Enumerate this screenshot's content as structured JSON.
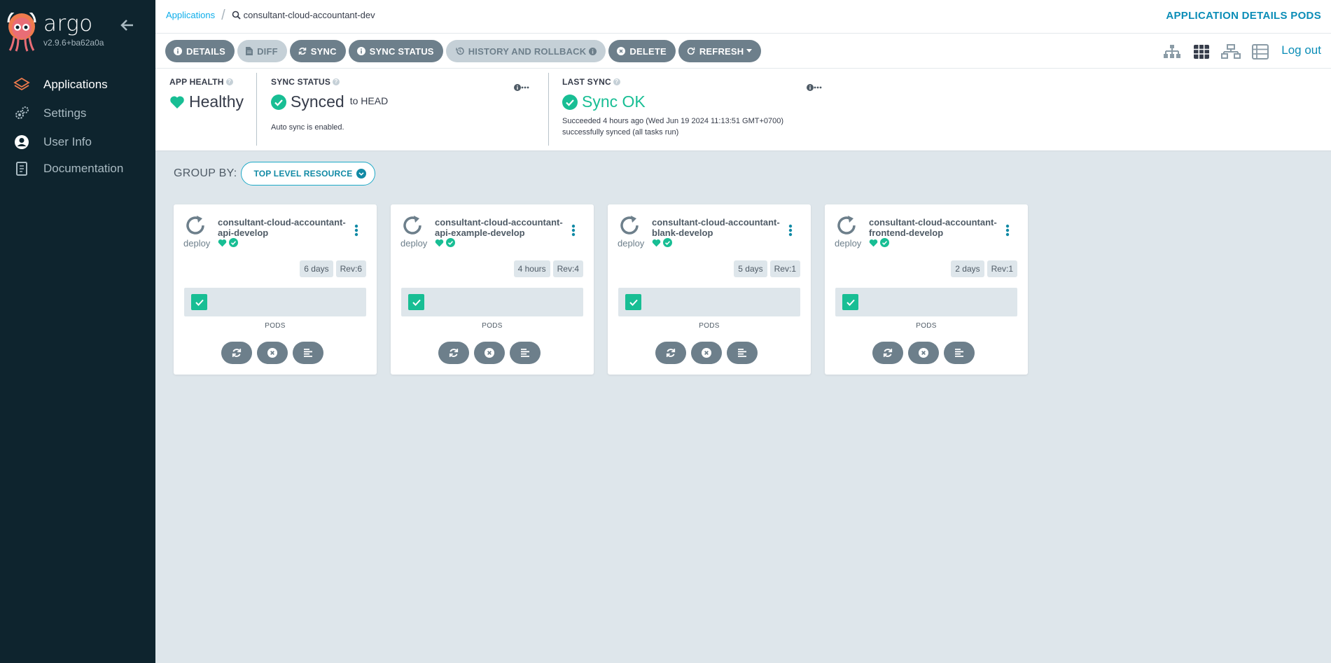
{
  "brand": {
    "name": "argo",
    "version": "v2.9.6+ba62a0a"
  },
  "nav": [
    {
      "label": "Applications",
      "active": true
    },
    {
      "label": "Settings",
      "active": false
    },
    {
      "label": "User Info",
      "active": false
    },
    {
      "label": "Documentation",
      "active": false
    }
  ],
  "breadcrumb": {
    "parent": "Applications",
    "current": "consultant-cloud-accountant-dev"
  },
  "topbar": {
    "right_title": "APPLICATION DETAILS PODS"
  },
  "toolbar": {
    "details": "DETAILS",
    "diff": "DIFF",
    "sync": "SYNC",
    "sync_status": "SYNC STATUS",
    "history": "HISTORY AND ROLLBACK",
    "delete": "DELETE",
    "refresh": "REFRESH",
    "logout": "Log out"
  },
  "status": {
    "health": {
      "title": "APP HEALTH",
      "value": "Healthy"
    },
    "sync": {
      "title": "SYNC STATUS",
      "value": "Synced",
      "target": "to HEAD",
      "note": "Auto sync is enabled."
    },
    "last_sync": {
      "title": "LAST SYNC",
      "value": "Sync OK",
      "detail1": "Succeeded 4 hours ago (Wed Jun 19 2024 11:13:51 GMT+0700)",
      "detail2": "successfully synced (all tasks run)"
    }
  },
  "group_by": {
    "label": "GROUP BY:",
    "value": "TOP LEVEL RESOURCE"
  },
  "cards": [
    {
      "line1": "consultant-cloud-accountant-",
      "line2": "api-develop",
      "kind": "deploy",
      "age": "6 days",
      "rev": "Rev:6",
      "pods_label": "PODS"
    },
    {
      "line1": "consultant-cloud-accountant-",
      "line2": "api-example-develop",
      "kind": "deploy",
      "age": "4 hours",
      "rev": "Rev:4",
      "pods_label": "PODS"
    },
    {
      "line1": "consultant-cloud-accountant-",
      "line2": "blank-develop",
      "kind": "deploy",
      "age": "5 days",
      "rev": "Rev:1",
      "pods_label": "PODS"
    },
    {
      "line1": "consultant-cloud-accountant-",
      "line2": "frontend-develop",
      "kind": "deploy",
      "age": "2 days",
      "rev": "Rev:1",
      "pods_label": "PODS"
    }
  ],
  "colors": {
    "sidebar": "#0e242e",
    "healthy": "#18be94",
    "accent": "#0dadea",
    "button": "#6d7f8b"
  }
}
